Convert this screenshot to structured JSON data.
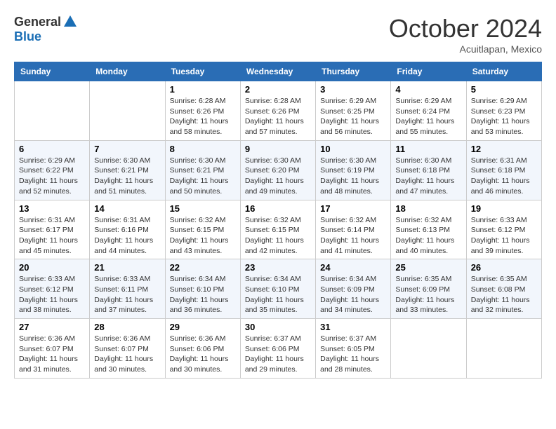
{
  "header": {
    "logo_line1": "General",
    "logo_line2": "Blue",
    "month": "October 2024",
    "location": "Acuitlapan, Mexico"
  },
  "weekdays": [
    "Sunday",
    "Monday",
    "Tuesday",
    "Wednesday",
    "Thursday",
    "Friday",
    "Saturday"
  ],
  "weeks": [
    [
      {
        "num": "",
        "info": ""
      },
      {
        "num": "",
        "info": ""
      },
      {
        "num": "1",
        "info": "Sunrise: 6:28 AM\nSunset: 6:26 PM\nDaylight: 11 hours and 58 minutes."
      },
      {
        "num": "2",
        "info": "Sunrise: 6:28 AM\nSunset: 6:26 PM\nDaylight: 11 hours and 57 minutes."
      },
      {
        "num": "3",
        "info": "Sunrise: 6:29 AM\nSunset: 6:25 PM\nDaylight: 11 hours and 56 minutes."
      },
      {
        "num": "4",
        "info": "Sunrise: 6:29 AM\nSunset: 6:24 PM\nDaylight: 11 hours and 55 minutes."
      },
      {
        "num": "5",
        "info": "Sunrise: 6:29 AM\nSunset: 6:23 PM\nDaylight: 11 hours and 53 minutes."
      }
    ],
    [
      {
        "num": "6",
        "info": "Sunrise: 6:29 AM\nSunset: 6:22 PM\nDaylight: 11 hours and 52 minutes."
      },
      {
        "num": "7",
        "info": "Sunrise: 6:30 AM\nSunset: 6:21 PM\nDaylight: 11 hours and 51 minutes."
      },
      {
        "num": "8",
        "info": "Sunrise: 6:30 AM\nSunset: 6:21 PM\nDaylight: 11 hours and 50 minutes."
      },
      {
        "num": "9",
        "info": "Sunrise: 6:30 AM\nSunset: 6:20 PM\nDaylight: 11 hours and 49 minutes."
      },
      {
        "num": "10",
        "info": "Sunrise: 6:30 AM\nSunset: 6:19 PM\nDaylight: 11 hours and 48 minutes."
      },
      {
        "num": "11",
        "info": "Sunrise: 6:30 AM\nSunset: 6:18 PM\nDaylight: 11 hours and 47 minutes."
      },
      {
        "num": "12",
        "info": "Sunrise: 6:31 AM\nSunset: 6:18 PM\nDaylight: 11 hours and 46 minutes."
      }
    ],
    [
      {
        "num": "13",
        "info": "Sunrise: 6:31 AM\nSunset: 6:17 PM\nDaylight: 11 hours and 45 minutes."
      },
      {
        "num": "14",
        "info": "Sunrise: 6:31 AM\nSunset: 6:16 PM\nDaylight: 11 hours and 44 minutes."
      },
      {
        "num": "15",
        "info": "Sunrise: 6:32 AM\nSunset: 6:15 PM\nDaylight: 11 hours and 43 minutes."
      },
      {
        "num": "16",
        "info": "Sunrise: 6:32 AM\nSunset: 6:15 PM\nDaylight: 11 hours and 42 minutes."
      },
      {
        "num": "17",
        "info": "Sunrise: 6:32 AM\nSunset: 6:14 PM\nDaylight: 11 hours and 41 minutes."
      },
      {
        "num": "18",
        "info": "Sunrise: 6:32 AM\nSunset: 6:13 PM\nDaylight: 11 hours and 40 minutes."
      },
      {
        "num": "19",
        "info": "Sunrise: 6:33 AM\nSunset: 6:12 PM\nDaylight: 11 hours and 39 minutes."
      }
    ],
    [
      {
        "num": "20",
        "info": "Sunrise: 6:33 AM\nSunset: 6:12 PM\nDaylight: 11 hours and 38 minutes."
      },
      {
        "num": "21",
        "info": "Sunrise: 6:33 AM\nSunset: 6:11 PM\nDaylight: 11 hours and 37 minutes."
      },
      {
        "num": "22",
        "info": "Sunrise: 6:34 AM\nSunset: 6:10 PM\nDaylight: 11 hours and 36 minutes."
      },
      {
        "num": "23",
        "info": "Sunrise: 6:34 AM\nSunset: 6:10 PM\nDaylight: 11 hours and 35 minutes."
      },
      {
        "num": "24",
        "info": "Sunrise: 6:34 AM\nSunset: 6:09 PM\nDaylight: 11 hours and 34 minutes."
      },
      {
        "num": "25",
        "info": "Sunrise: 6:35 AM\nSunset: 6:09 PM\nDaylight: 11 hours and 33 minutes."
      },
      {
        "num": "26",
        "info": "Sunrise: 6:35 AM\nSunset: 6:08 PM\nDaylight: 11 hours and 32 minutes."
      }
    ],
    [
      {
        "num": "27",
        "info": "Sunrise: 6:36 AM\nSunset: 6:07 PM\nDaylight: 11 hours and 31 minutes."
      },
      {
        "num": "28",
        "info": "Sunrise: 6:36 AM\nSunset: 6:07 PM\nDaylight: 11 hours and 30 minutes."
      },
      {
        "num": "29",
        "info": "Sunrise: 6:36 AM\nSunset: 6:06 PM\nDaylight: 11 hours and 30 minutes."
      },
      {
        "num": "30",
        "info": "Sunrise: 6:37 AM\nSunset: 6:06 PM\nDaylight: 11 hours and 29 minutes."
      },
      {
        "num": "31",
        "info": "Sunrise: 6:37 AM\nSunset: 6:05 PM\nDaylight: 11 hours and 28 minutes."
      },
      {
        "num": "",
        "info": ""
      },
      {
        "num": "",
        "info": ""
      }
    ]
  ]
}
